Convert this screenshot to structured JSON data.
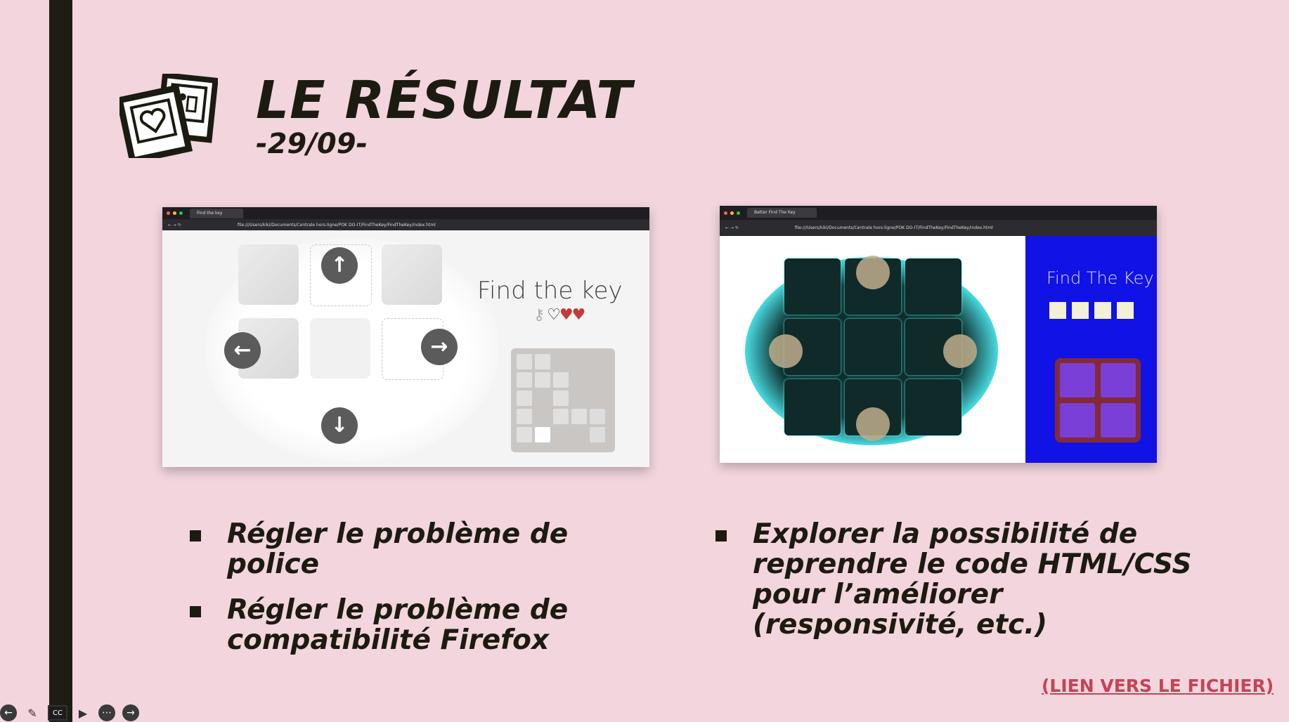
{
  "slide": {
    "title": "LE RÉSULTAT",
    "subtitle": "-29/09-",
    "left_bullets": [
      "Régler le problème de police",
      "Régler le problème de compatibilité Firefox"
    ],
    "right_bullets": [
      "Explorer la possibilité de reprendre le code HTML/CSS pour l’améliorer (responsivité, etc.)"
    ],
    "link_text": "(LIEN VERS LE FICHIER)",
    "link_color": "#c44455",
    "background_color": "#f3d5de"
  },
  "screenshot1": {
    "tab_title": "Find the key",
    "url": "file:///Users/kiki/Documents/Centrale hors-ligne/POK DO-IT/FindTheKey/FindTheKey/index.html",
    "game_title": "Find the key",
    "icons": [
      "up-arrow-icon",
      "left-arrow-icon",
      "right-arrow-icon",
      "down-arrow-icon",
      "key-icon",
      "heart-icon"
    ]
  },
  "screenshot2": {
    "tab_title": "Better Find The Key",
    "url": "file:///Users/kiki/Documents/Centrale hors-ligne/POK DO-IT/FindTheKey/FindTheKey/index.html",
    "game_title": "Find The Key"
  },
  "controls": [
    "previous-icon",
    "pen-icon",
    "captions-icon",
    "camera-icon",
    "more-icon",
    "next-icon"
  ]
}
